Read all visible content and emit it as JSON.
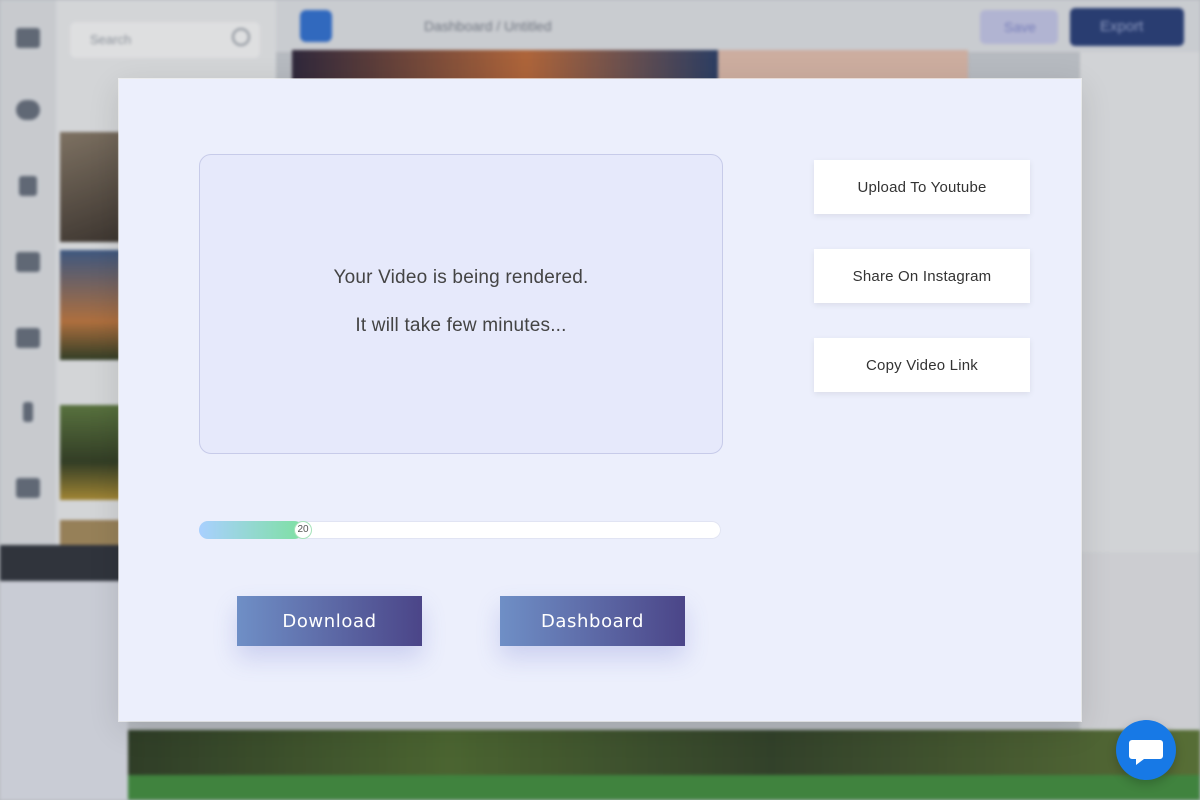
{
  "background": {
    "search_placeholder": "Search",
    "breadcrumb": "Dashboard / Untitled",
    "save_label": "Save",
    "export_label": "Export"
  },
  "modal": {
    "status_line_1": "Your Video is being rendered.",
    "status_line_2": "It will take few minutes...",
    "progress": {
      "percent": 20,
      "label": "20"
    },
    "buttons": {
      "download": "Download",
      "dashboard": "Dashboard"
    },
    "share_actions": [
      {
        "label": "Upload To Youtube"
      },
      {
        "label": "Share On Instagram"
      },
      {
        "label": "Copy Video Link"
      }
    ]
  },
  "chat_widget": {
    "icon": "chat-bubble-icon"
  }
}
